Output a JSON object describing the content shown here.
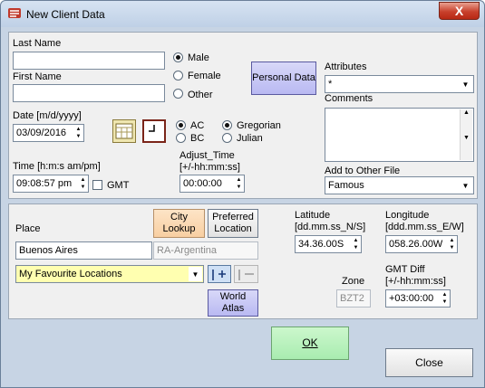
{
  "window": {
    "title": "New Client Data",
    "close_glyph": "X"
  },
  "identity": {
    "last_name_label": "Last Name",
    "last_name_value": "",
    "first_name_label": "First Name",
    "first_name_value": "",
    "gender_options": [
      {
        "label": "Male",
        "selected": true
      },
      {
        "label": "Female",
        "selected": false
      },
      {
        "label": "Other",
        "selected": false
      }
    ],
    "personal_data_button": "Personal Data"
  },
  "attributes": {
    "label": "Attributes",
    "value": "*",
    "comments_label": "Comments",
    "comments_value": "",
    "add_to_file_label": "Add to Other File",
    "add_to_file_value": "Famous"
  },
  "datetime": {
    "date_label": "Date [m/d/yyyy]",
    "date_value": "03/09/2016",
    "era_options": [
      {
        "label": "AC",
        "selected": true
      },
      {
        "label": "BC",
        "selected": false
      }
    ],
    "calendar_options": [
      {
        "label": "Gregorian",
        "selected": true
      },
      {
        "label": "Julian",
        "selected": false
      }
    ],
    "time_label": "Time [h:m:s am/pm]",
    "time_value": "09:08:57 pm",
    "gmt_label": "GMT",
    "gmt_checked": false,
    "adjust_time_label_1": "Adjust_Time",
    "adjust_time_label_2": "[+/-hh:mm:ss]",
    "adjust_time_value": "00:00:00"
  },
  "location": {
    "place_label": "Place",
    "city_lookup_button": "City Lookup",
    "preferred_location_button": "Preferred Location",
    "place_value": "Buenos Aires",
    "region_value": "RA-Argentina",
    "favourites_value": "My Favourite Locations",
    "world_atlas_button": "World Atlas",
    "latitude_label_1": "Latitude",
    "latitude_label_2": "[dd.mm.ss_N/S]",
    "latitude_value": "34.36.00S",
    "longitude_label_1": "Longitude",
    "longitude_label_2": "[ddd.mm.ss_E/W]",
    "longitude_value": "058.26.00W",
    "zone_label": "Zone",
    "zone_value": "BZT2",
    "gmt_diff_label_1": "GMT Diff",
    "gmt_diff_label_2": "[+/-hh:mm:ss]",
    "gmt_diff_value": "+03:00:00"
  },
  "footer": {
    "ok_button": "OK",
    "close_button": "Close"
  },
  "colors": {
    "window_frame": "#c7d4e4",
    "panel": "#f0f0f0",
    "personal_data_button": "#b9b9f2",
    "city_lookup_button": "#f8cfa2",
    "ok_button": "#a9ecb0",
    "close_button_red": "#c8402c"
  }
}
